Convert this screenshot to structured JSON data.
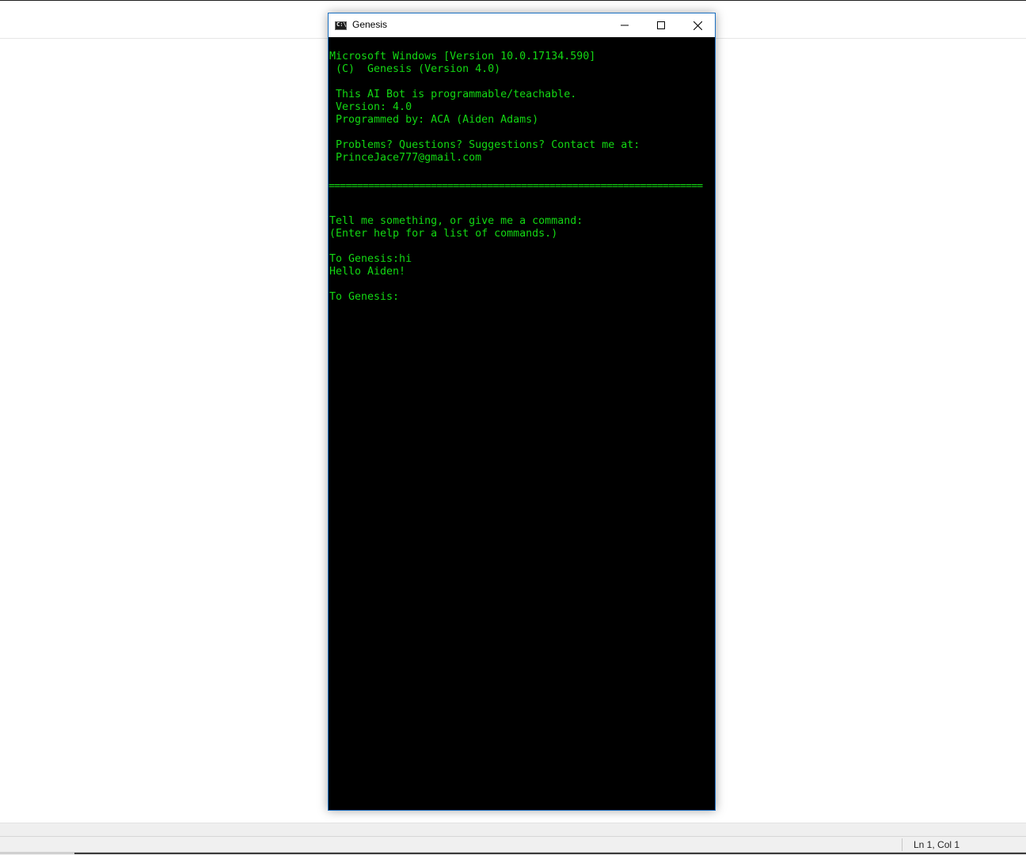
{
  "background": {
    "status_position": "Ln 1, Col 1"
  },
  "window": {
    "title": "Genesis",
    "icon": "console-icon",
    "controls": [
      "minimize-icon",
      "maximize-icon",
      "close-icon"
    ]
  },
  "console": {
    "text_color": "#13d813",
    "background_color": "#000000",
    "lines": {
      "l1": "Microsoft Windows [Version 10.0.17134.590]",
      "l2": " (C)  Genesis (Version 4.0)",
      "l3": " This AI Bot is programmable/teachable.",
      "l4": " Version: 4.0",
      "l5": " Programmed by: ACA (Aiden Adams)",
      "l6": " Problems? Questions? Suggestions? Contact me at:",
      "l7": " PrinceJace777@gmail.com",
      "divider": "==================================================================",
      "l8": "Tell me something, or give me a command:",
      "l9": "(Enter help for a list of commands.)",
      "l10": "To Genesis:hi",
      "l11": "Hello Aiden!",
      "prompt": "To Genesis:"
    }
  }
}
